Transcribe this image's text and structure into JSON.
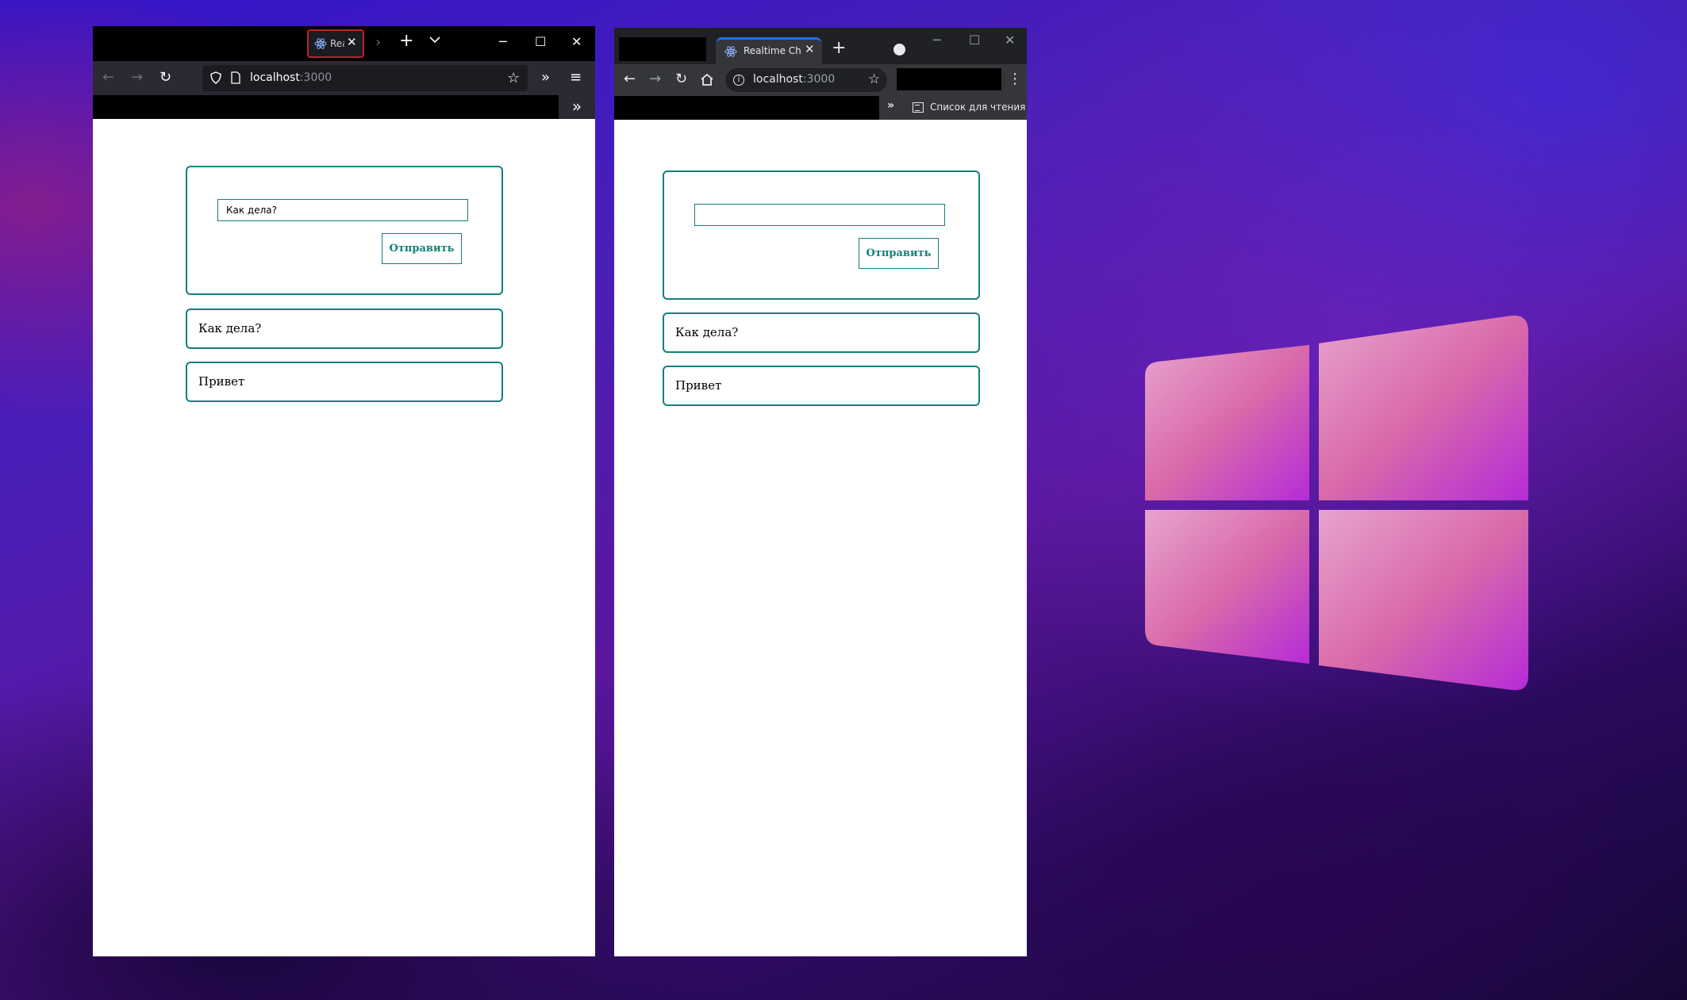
{
  "screen": {
    "logo_icon": "windows-logo-icon"
  },
  "firefox": {
    "tab": {
      "title": "Rea",
      "icon": "react-icon"
    },
    "address": {
      "host": "localhost",
      "port": ":3000"
    },
    "window_controls": [
      "minimize",
      "maximize",
      "close"
    ]
  },
  "chrome": {
    "tab": {
      "title": "Realtime Cha",
      "icon": "react-icon"
    },
    "address": {
      "host": "localhost",
      "port": ":3000"
    },
    "bookmarks": {
      "reading_list": "Список для чтения"
    },
    "window_controls": [
      "minimize",
      "maximize",
      "close"
    ]
  },
  "left_app": {
    "input": {
      "value": "Как дела?",
      "placeholder": ""
    },
    "send_label": "Отправить",
    "messages": [
      "Как дела?",
      "Привет"
    ]
  },
  "right_app": {
    "input": {
      "value": "",
      "placeholder": ""
    },
    "send_label": "Отправить",
    "messages": [
      "Как дела?",
      "Привет"
    ]
  },
  "colors": {
    "accent": "#12807b",
    "firefox_tab_border": "#b3262d",
    "chrome_tab_indicator": "#1a73e8"
  }
}
